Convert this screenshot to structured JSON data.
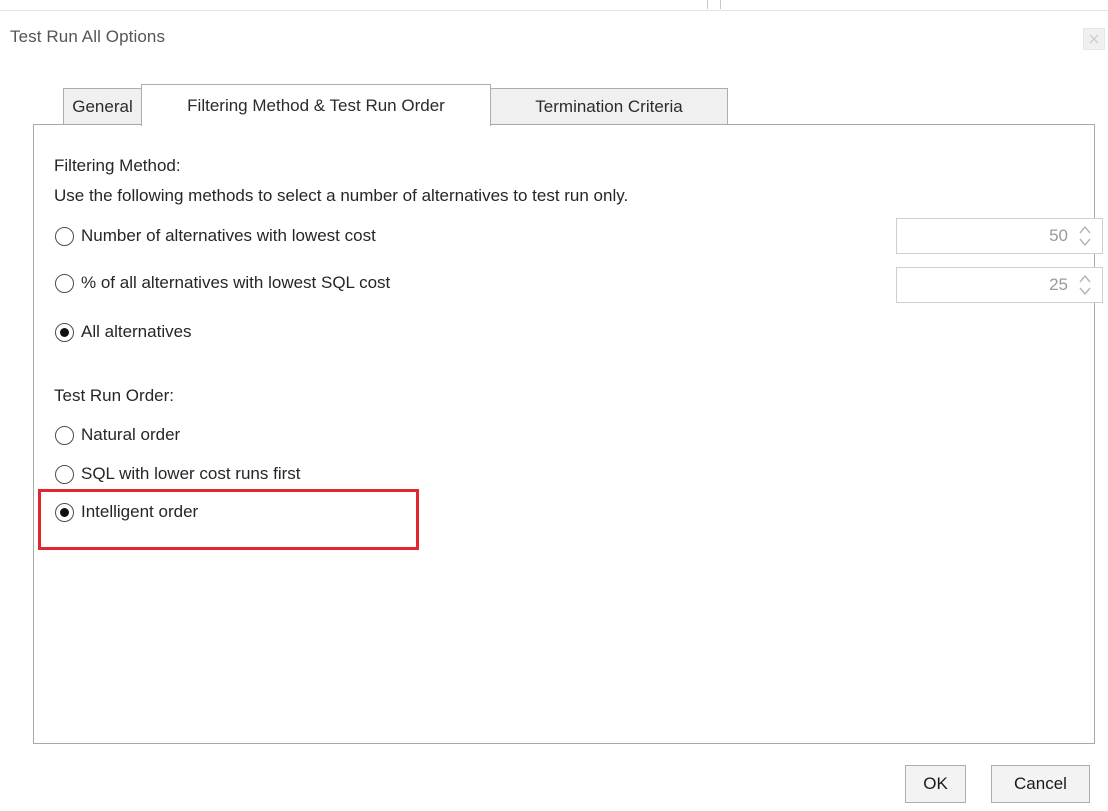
{
  "window": {
    "title": "Test Run All Options"
  },
  "tabs": [
    {
      "label": "General",
      "active": false
    },
    {
      "label": "Filtering Method & Test Run Order",
      "active": true
    },
    {
      "label": "Termination Criteria",
      "active": false
    }
  ],
  "filtering": {
    "heading": "Filtering Method:",
    "description": "Use the following methods to select a number of alternatives to test run only.",
    "options": [
      {
        "label": "Number of alternatives with lowest cost",
        "checked": false,
        "spinner_value": "50"
      },
      {
        "label": "% of all alternatives with lowest SQL cost",
        "checked": false,
        "spinner_value": "25"
      },
      {
        "label": "All alternatives",
        "checked": true
      }
    ]
  },
  "test_run_order": {
    "heading": "Test Run Order:",
    "options": [
      {
        "label": "Natural order",
        "checked": false
      },
      {
        "label": "SQL with lower cost runs first",
        "checked": false
      },
      {
        "label": "Intelligent order",
        "checked": true
      }
    ]
  },
  "buttons": {
    "ok": "OK",
    "cancel": "Cancel"
  },
  "colors": {
    "highlight": "#e0262f",
    "panel_border": "#a8a8a8",
    "tab_background": "#f0f0f0"
  },
  "icons": {
    "close": "close-icon",
    "spinner": "spinner-arrows-icon"
  }
}
